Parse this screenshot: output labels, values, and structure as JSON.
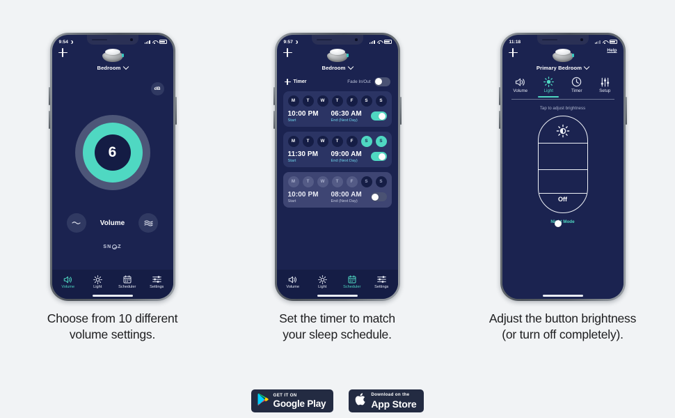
{
  "background_color": "#f1f3f5",
  "accent_color": "#4fd8c2",
  "screen_bg": "#1b2350",
  "panels": [
    {
      "id": "volume-panel",
      "caption_line1": "Choose from 10 different",
      "caption_line2": "volume settings.",
      "phone": {
        "status_time": "9:54",
        "status_icons": [
          "moon-icon",
          "signal-icon",
          "wifi-icon",
          "battery-icon"
        ],
        "room_name": "Bedroom",
        "add_icon": "plus-icon",
        "db_button": "dB",
        "volume_value": "6",
        "volume_label": "Volume",
        "decrease_icon": "wave-low-icon",
        "increase_icon": "wave-high-icon",
        "brand": "SNOOZ",
        "nav": [
          {
            "label": "Volume",
            "icon": "speaker-icon",
            "active": true
          },
          {
            "label": "Light",
            "icon": "sun-icon",
            "active": false
          },
          {
            "label": "Scheduler",
            "icon": "calendar-icon",
            "active": false
          },
          {
            "label": "Settings",
            "icon": "sliders-icon",
            "active": false
          }
        ]
      }
    },
    {
      "id": "scheduler-panel",
      "caption_line1": "Set the timer to match",
      "caption_line2": "your sleep schedule.",
      "phone": {
        "status_time": "9:57",
        "room_name": "Bedroom",
        "timer_add_label": "Timer",
        "fade_label": "Fade In/Out",
        "fade_on": false,
        "schedules": [
          {
            "days": [
              "M",
              "T",
              "W",
              "T",
              "F",
              "S",
              "S"
            ],
            "days_active": [
              false,
              false,
              false,
              false,
              false,
              false,
              false
            ],
            "start_time": "10:00 PM",
            "start_label": "Start",
            "end_time": "06:30 AM",
            "end_label": "End (Next Day)",
            "enabled": true,
            "dimmed": false
          },
          {
            "days": [
              "M",
              "T",
              "W",
              "T",
              "F",
              "S",
              "S"
            ],
            "days_active": [
              false,
              false,
              false,
              false,
              false,
              true,
              true
            ],
            "start_time": "11:30 PM",
            "start_label": "Start",
            "end_time": "09:00 AM",
            "end_label": "End (Next Day)",
            "enabled": true,
            "dimmed": false
          },
          {
            "days": [
              "M",
              "T",
              "W",
              "T",
              "F",
              "S",
              "S"
            ],
            "days_active": [
              false,
              false,
              false,
              false,
              false,
              true,
              true
            ],
            "start_time": "10:00 PM",
            "start_label": "Start",
            "end_time": "08:00 AM",
            "end_label": "End (Next Day)",
            "enabled": false,
            "dimmed": true
          }
        ],
        "nav": [
          {
            "label": "Volume",
            "icon": "speaker-icon",
            "active": false
          },
          {
            "label": "Light",
            "icon": "sun-icon",
            "active": false
          },
          {
            "label": "Scheduler",
            "icon": "calendar-icon",
            "active": true
          },
          {
            "label": "Settings",
            "icon": "sliders-icon",
            "active": false
          }
        ]
      }
    },
    {
      "id": "light-panel",
      "caption_line1": "Adjust the button brightness",
      "caption_line2": "(or turn off completely).",
      "phone": {
        "status_time": "11:18",
        "help_label": "Help",
        "room_name": "Primary Bedroom",
        "tabs": [
          {
            "label": "Volume",
            "icon": "speaker-icon",
            "active": false
          },
          {
            "label": "Light",
            "icon": "sun-icon",
            "active": true
          },
          {
            "label": "Timer",
            "icon": "clock-icon",
            "active": false
          },
          {
            "label": "Setup",
            "icon": "sliders-icon",
            "active": false
          }
        ],
        "hint": "Tap to adjust brightness",
        "slider_top_icon": "brightness-sun-icon",
        "slider_off_label": "Off",
        "night_mode_label": "Night Mode",
        "night_mode_on": true
      }
    }
  ],
  "store_badges": [
    {
      "id": "google-play-badge",
      "small": "GET IT ON",
      "big": "Google Play",
      "icon": "google-play-icon"
    },
    {
      "id": "app-store-badge",
      "small": "Download on the",
      "big": "App Store",
      "icon": "apple-icon"
    }
  ]
}
